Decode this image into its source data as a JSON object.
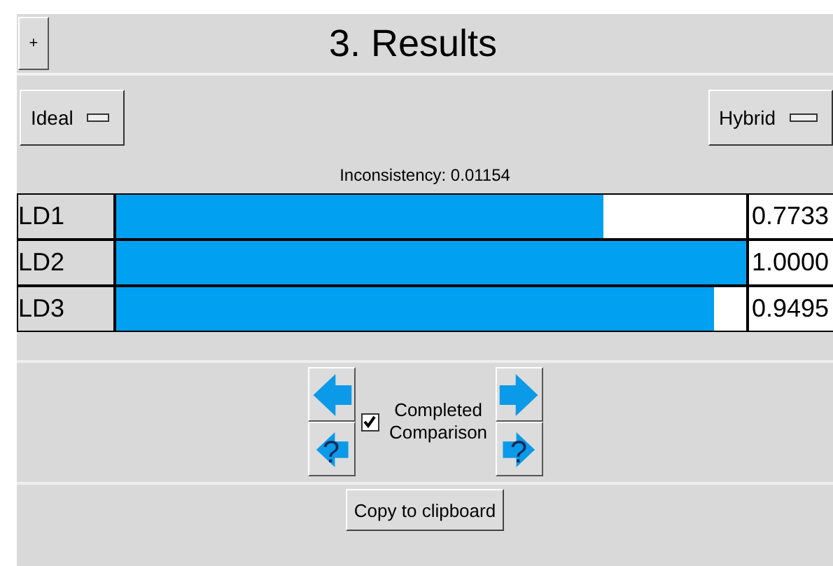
{
  "header": {
    "expand_button": "+",
    "title": "3. Results"
  },
  "dropdowns": {
    "left": "Ideal",
    "right": "Hybrid"
  },
  "inconsistency": "Inconsistency: 0.01154",
  "results": [
    {
      "label": "LD1",
      "level": 0.7733,
      "value": "0.7733"
    },
    {
      "label": "LD2",
      "level": 1.0,
      "value": "1.0000"
    },
    {
      "label": "LD3",
      "level": 0.9495,
      "value": "0.9495"
    }
  ],
  "navigation": {
    "help_mark": "?",
    "completed": {
      "label": "Completed Comparison",
      "checked": true
    }
  },
  "copy_button": "Copy to clipboard"
}
